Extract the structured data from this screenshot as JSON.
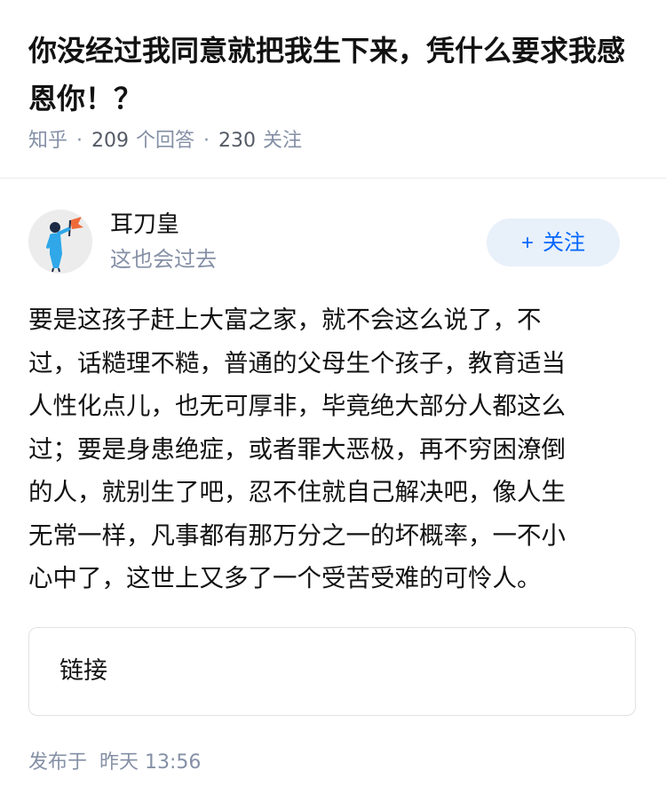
{
  "question": {
    "title": "你没经过我同意就把我生下来，凭什么要求我感恩你！？",
    "source": "知乎",
    "separator": "·",
    "answer_count": "209",
    "answer_label": "个回答",
    "follower_count": "230",
    "follower_label": "关注"
  },
  "author": {
    "name": "耳刀皇",
    "bio": "这也会过去",
    "avatar_icon": "avatar-figure-with-flag-icon"
  },
  "follow_button": {
    "plus": "+",
    "label": "关注"
  },
  "answer": {
    "lines": [
      "要是这孩子赶上大富之家，就不会这么说了，不",
      "过，话糙理不糙，普通的父母生个孩子，教育适当",
      "人性化点儿，也无可厚非，毕竟绝大部分人都这么",
      "过；要是身患绝症，或者罪大恶极，再不穷困潦倒",
      "的人，就别生了吧，忍不住就自己解决吧，像人生",
      "无常一样，凡事都有那万分之一的坏概率，一不小",
      "心中了，这世上又多了一个受苦受难的可怜人。"
    ]
  },
  "link_card": {
    "label": "链接"
  },
  "published": {
    "label": "发布于",
    "time": "昨天 13:56"
  },
  "colors": {
    "title": "#121212",
    "meta": "#8590a6",
    "accent": "#0066ff",
    "follow_bg": "#e8f0fa"
  }
}
